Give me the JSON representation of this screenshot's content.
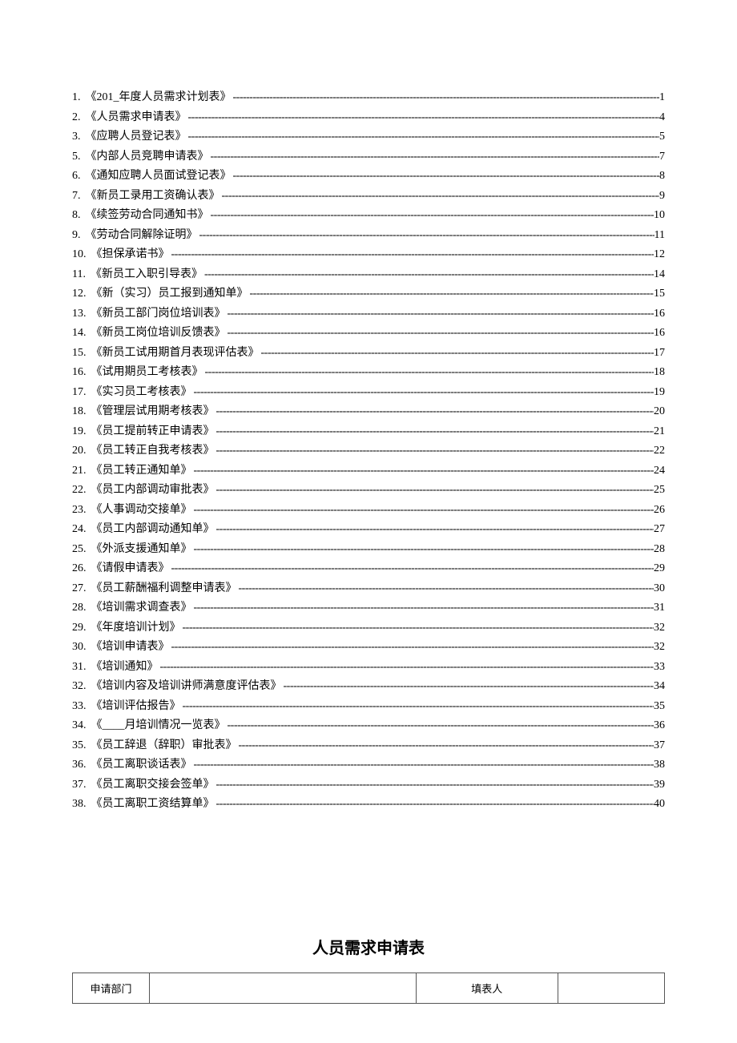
{
  "toc": {
    "items": [
      {
        "num": "1.",
        "title": "《201_年度人员需求计划表》",
        "page": "1"
      },
      {
        "num": "2.",
        "title": "《人员需求申请表》",
        "page": "4"
      },
      {
        "num": "3.",
        "title": "《应聘人员登记表》",
        "page": "5"
      },
      {
        "num": "5.",
        "title": "《内部人员竞聘申请表》",
        "page": "7"
      },
      {
        "num": "6.",
        "title": "《通知应聘人员面试登记表》",
        "page": "8"
      },
      {
        "num": "7.",
        "title": "《新员工录用工资确认表》",
        "page": "9"
      },
      {
        "num": "8.",
        "title": "《续签劳动合同通知书》",
        "page": "10"
      },
      {
        "num": "9.",
        "title": "《劳动合同解除证明》",
        "page": "11"
      },
      {
        "num": "10.",
        "title": "《担保承诺书》",
        "page": "12"
      },
      {
        "num": "11.",
        "title": "《新员工入职引导表》",
        "page": "14"
      },
      {
        "num": "12.",
        "title": "《新（实习）员工报到通知单》",
        "page": "15"
      },
      {
        "num": "13.",
        "title": "《新员工部门岗位培训表》",
        "page": "16"
      },
      {
        "num": "14.",
        "title": "《新员工岗位培训反馈表》",
        "page": "16"
      },
      {
        "num": "15.",
        "title": "《新员工试用期首月表现评估表》",
        "page": "17"
      },
      {
        "num": "16.",
        "title": "《试用期员工考核表》",
        "page": "18"
      },
      {
        "num": "17.",
        "title": "《实习员工考核表》",
        "page": "19"
      },
      {
        "num": "18.",
        "title": "《管理层试用期考核表》",
        "page": "20"
      },
      {
        "num": "19.",
        "title": "《员工提前转正申请表》",
        "page": "21"
      },
      {
        "num": "20.",
        "title": "《员工转正自我考核表》",
        "page": "22"
      },
      {
        "num": "21.",
        "title": "《员工转正通知单》",
        "page": "24"
      },
      {
        "num": "22.",
        "title": "《员工内部调动审批表》",
        "page": "25"
      },
      {
        "num": "23.",
        "title": "《人事调动交接单》",
        "page": "26"
      },
      {
        "num": "24.",
        "title": "《员工内部调动通知单》",
        "page": "27"
      },
      {
        "num": "25.",
        "title": "《外派支援通知单》",
        "page": "28"
      },
      {
        "num": "26.",
        "title": "《请假申请表》",
        "page": "29"
      },
      {
        "num": "27.",
        "title": "《员工薪酬福利调整申请表》",
        "page": "30"
      },
      {
        "num": "28.",
        "title": "《培训需求调查表》",
        "page": "31"
      },
      {
        "num": "29.",
        "title": "《年度培训计划》",
        "page": "32"
      },
      {
        "num": "30.",
        "title": "《培训申请表》",
        "page": "32"
      },
      {
        "num": "31.",
        "title": "《培训通知》",
        "page": "33"
      },
      {
        "num": "32.",
        "title": "《培训内容及培训讲师满意度评估表》",
        "page": "34"
      },
      {
        "num": "33.",
        "title": "《培训评估报告》",
        "page": "35"
      },
      {
        "num": "34.",
        "title": "《____月培训情况一览表》",
        "page": "36"
      },
      {
        "num": "35.",
        "title": "《员工辞退（辞职）审批表》",
        "page": "37"
      },
      {
        "num": "36.",
        "title": "《员工离职谈话表》",
        "page": "38"
      },
      {
        "num": "37.",
        "title": "《员工离职交接会签单》",
        "page": "39"
      },
      {
        "num": "38.",
        "title": "《员工离职工资结算单》",
        "page": "40"
      }
    ]
  },
  "section": {
    "title": "人员需求申请表"
  },
  "form": {
    "row1": {
      "label1": "申请部门",
      "value1": "",
      "label2": "填表人",
      "value2": ""
    }
  }
}
